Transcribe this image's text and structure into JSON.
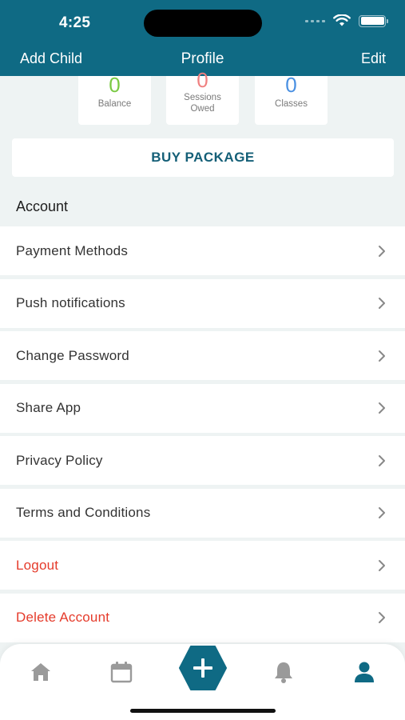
{
  "status_bar": {
    "time": "4:25"
  },
  "header": {
    "left_action": "Add Child",
    "title": "Profile",
    "right_action": "Edit"
  },
  "stats": [
    {
      "value": "0",
      "label": "Balance",
      "color": "#7ac943"
    },
    {
      "value": "0",
      "label": "Sessions Owed",
      "color": "#f08080"
    },
    {
      "value": "0",
      "label": "Classes",
      "color": "#4a90e2"
    }
  ],
  "buy_package": "BUY PACKAGE",
  "section_title": "Account",
  "menu": [
    {
      "label": "Payment Methods"
    },
    {
      "label": "Push notifications"
    },
    {
      "label": "Change Password"
    },
    {
      "label": "Share App"
    },
    {
      "label": "Privacy Policy"
    },
    {
      "label": "Terms and Conditions"
    },
    {
      "label": "Logout"
    },
    {
      "label": "Delete Account"
    }
  ],
  "tabbar": {
    "icons": [
      "home-icon",
      "calendar-icon",
      "plus-icon",
      "bell-icon",
      "user-icon"
    ],
    "accent": "#0f6a84",
    "inactive": "#9a9a9a"
  },
  "colors": {
    "header": "#0f6a84",
    "danger": "#e53b2b",
    "background": "#eef3f3"
  }
}
